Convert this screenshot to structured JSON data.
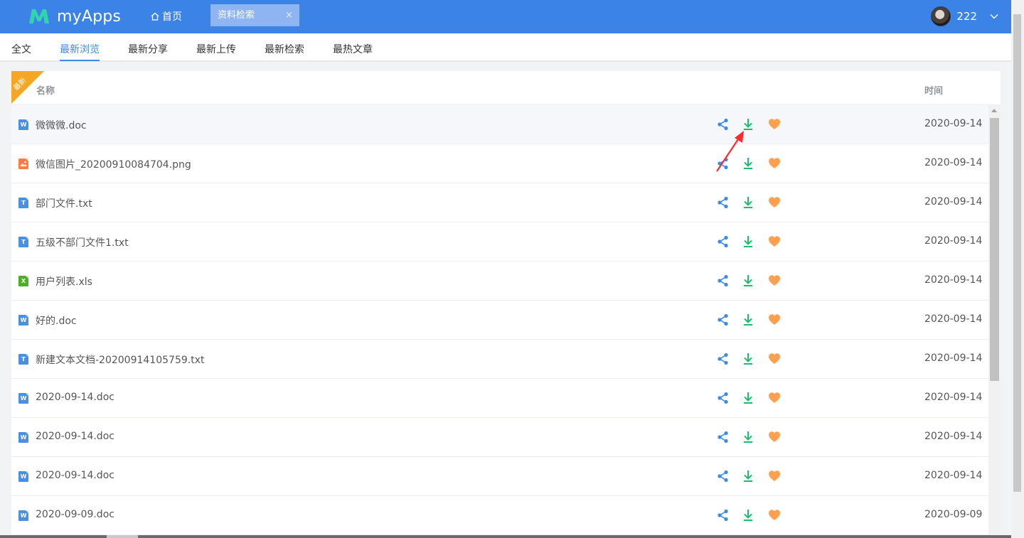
{
  "header": {
    "app_name": "myApps",
    "home_label": "首页",
    "open_tab_label": "资料检索",
    "close_glyph": "×",
    "user_name": "222",
    "brand_color": "#3c83e8"
  },
  "subnav": {
    "tabs": [
      "全文",
      "最新浏览",
      "最新分享",
      "最新上传",
      "最新检索",
      "最热文章"
    ],
    "active_index": 1
  },
  "table": {
    "ribbon_label": "最新",
    "col_name": "名称",
    "col_time": "时间",
    "rows": [
      {
        "type": "doc",
        "icon_letter": "W",
        "name": "微微微.doc",
        "time": "2020-09-14"
      },
      {
        "type": "png",
        "icon_letter": "",
        "name": "微信图片_20200910084704.png",
        "time": "2020-09-14"
      },
      {
        "type": "txt",
        "icon_letter": "T",
        "name": "部门文件.txt",
        "time": "2020-09-14"
      },
      {
        "type": "txt",
        "icon_letter": "T",
        "name": "五级不部门文件1.txt",
        "time": "2020-09-14"
      },
      {
        "type": "xls",
        "icon_letter": "X",
        "name": "用户列表.xls",
        "time": "2020-09-14"
      },
      {
        "type": "doc",
        "icon_letter": "W",
        "name": "好的.doc",
        "time": "2020-09-14"
      },
      {
        "type": "txt",
        "icon_letter": "T",
        "name": "新建文本文档-20200914105759.txt",
        "time": "2020-09-14"
      },
      {
        "type": "doc",
        "icon_letter": "W",
        "name": "2020-09-14.doc",
        "time": "2020-09-14"
      },
      {
        "type": "doc",
        "icon_letter": "W",
        "name": "2020-09-14.doc",
        "time": "2020-09-14"
      },
      {
        "type": "doc",
        "icon_letter": "W",
        "name": "2020-09-14.doc",
        "time": "2020-09-14"
      },
      {
        "type": "doc",
        "icon_letter": "W",
        "name": "2020-09-09.doc",
        "time": "2020-09-09"
      }
    ],
    "icons": {
      "share": "share-icon",
      "download": "download-icon",
      "favorite": "heart-icon"
    },
    "colors": {
      "share": "#3c8ae6",
      "download": "#19be6b",
      "favorite": "#ff9f50",
      "annotation_arrow": "#ff2a2a"
    }
  }
}
